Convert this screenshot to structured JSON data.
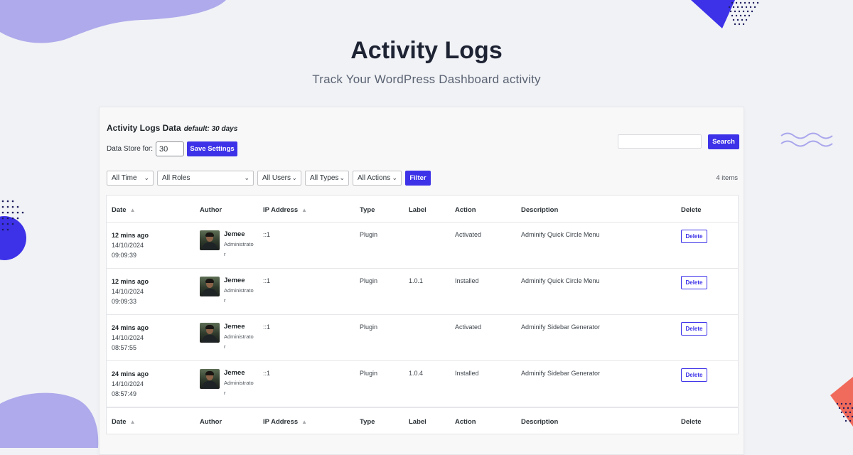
{
  "hero": {
    "title": "Activity Logs",
    "subtitle": "Track Your WordPress Dashboard activity"
  },
  "panel": {
    "heading": "Activity Logs Data",
    "heading_note": "default: 30 days",
    "store_label": "Data Store for:",
    "store_value": "30",
    "save_label": "Save Settings",
    "search_value": "",
    "search_label": "Search"
  },
  "filters": {
    "time": "All Time",
    "roles": "All Roles",
    "users": "All Users",
    "types": "All Types",
    "actions": "All Actions",
    "filter_label": "Filter",
    "items_count": "4 items"
  },
  "table": {
    "columns": {
      "date": "Date",
      "author": "Author",
      "ip": "IP Address",
      "type": "Type",
      "label": "Label",
      "action": "Action",
      "description": "Description",
      "delete": "Delete"
    },
    "rows": [
      {
        "rel": "12 mins ago",
        "date": "14/10/2024",
        "time": "09:09:39",
        "user": "Jemee",
        "role": "Administrator",
        "ip": "::1",
        "type": "Plugin",
        "label": "",
        "action": "Activated",
        "description": "Adminify Quick Circle Menu",
        "delete": "Delete"
      },
      {
        "rel": "12 mins ago",
        "date": "14/10/2024",
        "time": "09:09:33",
        "user": "Jemee",
        "role": "Administrator",
        "ip": "::1",
        "type": "Plugin",
        "label": "1.0.1",
        "action": "Installed",
        "description": "Adminify Quick Circle Menu",
        "delete": "Delete"
      },
      {
        "rel": "24 mins ago",
        "date": "14/10/2024",
        "time": "08:57:55",
        "user": "Jemee",
        "role": "Administrator",
        "ip": "::1",
        "type": "Plugin",
        "label": "",
        "action": "Activated",
        "description": "Adminify Sidebar Generator",
        "delete": "Delete"
      },
      {
        "rel": "24 mins ago",
        "date": "14/10/2024",
        "time": "08:57:49",
        "user": "Jemee",
        "role": "Administrator",
        "ip": "::1",
        "type": "Plugin",
        "label": "1.0.4",
        "action": "Installed",
        "description": "Adminify Sidebar Generator",
        "delete": "Delete"
      }
    ]
  },
  "icons": {
    "sort": "sort-arrows-icon",
    "chevron": "chevron-down-icon",
    "avatar": "user-avatar"
  },
  "colors": {
    "accent": "#3d32e8",
    "blob": "#a9a6ec",
    "coral": "#f06b5c",
    "background": "#f1f2f6"
  }
}
